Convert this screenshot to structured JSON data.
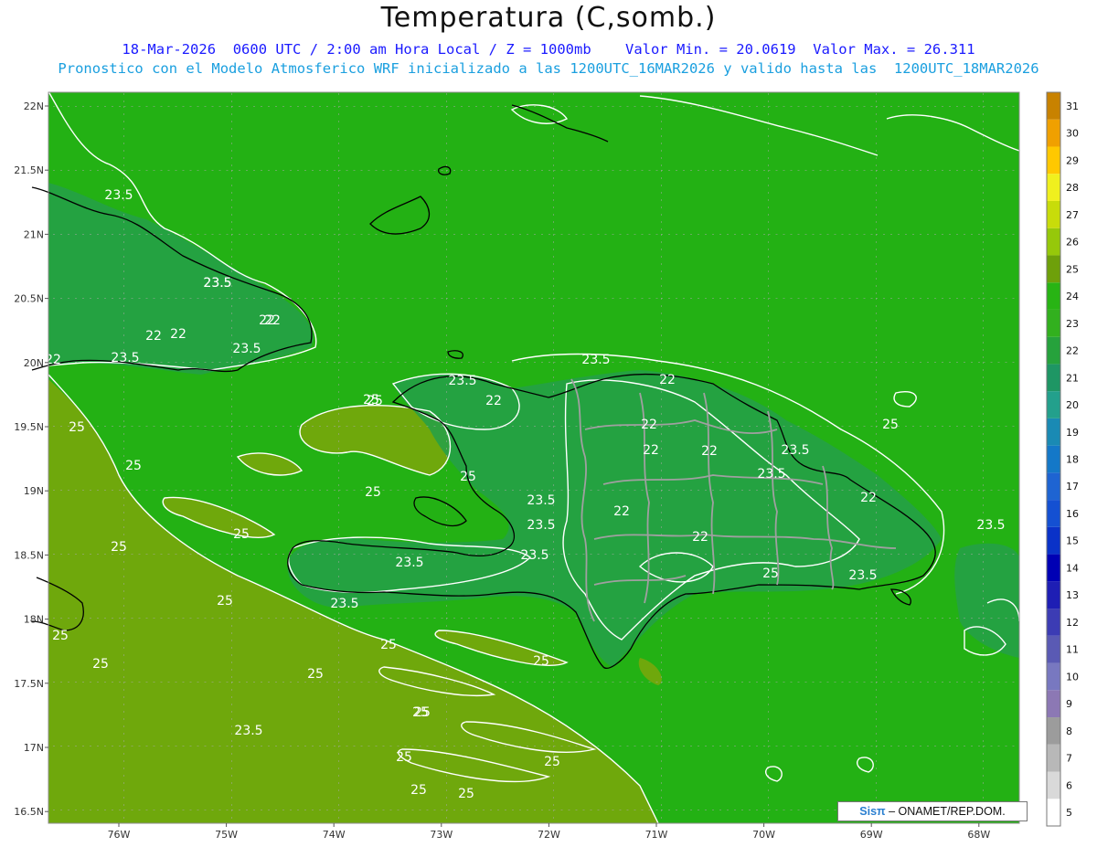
{
  "header": {
    "title": "Temperatura (C,somb.)",
    "line1": "18-Mar-2026  0600 UTC / 2:00 am Hora Local / Z = 1000mb    Valor Min. = 20.0619  Valor Max. = 26.311",
    "line2": "Pronostico con el Modelo Atmosferico WRF inicializado a las 1200UTC_16MAR2026 y valido hasta las  1200UTC_18MAR2026"
  },
  "axes": {
    "lat_ticks": [
      "22N",
      "21.5N",
      "21N",
      "20.5N",
      "20N",
      "19.5N",
      "19N",
      "18.5N",
      "18N",
      "17.5N",
      "17N",
      "16.5N"
    ],
    "lon_ticks": [
      "76W",
      "75W",
      "74W",
      "73W",
      "72W",
      "71W",
      "70W",
      "69W",
      "68W"
    ]
  },
  "colorbar": {
    "values": [
      "5",
      "6",
      "7",
      "8",
      "9",
      "10",
      "11",
      "12",
      "13",
      "14",
      "15",
      "16",
      "17",
      "18",
      "19",
      "20",
      "21",
      "22",
      "23",
      "24",
      "25",
      "26",
      "27",
      "28",
      "29",
      "30",
      "31"
    ],
    "colors": [
      "#ffffff",
      "#d9d9d9",
      "#b8b8b8",
      "#9c9c9c",
      "#8c78b4",
      "#7878c0",
      "#5a5ab4",
      "#3c3cb4",
      "#1e1eb4",
      "#0000b4",
      "#0a32c8",
      "#1450d2",
      "#1e64d2",
      "#1478c8",
      "#1a8ab4",
      "#23a08c",
      "#1e9664",
      "#26a23c",
      "#32b01e",
      "#28b414",
      "#6ea00a",
      "#96c80a",
      "#c8dc0a",
      "#f0f01e",
      "#ffc800",
      "#f0a000",
      "#c88200"
    ]
  },
  "field": {
    "sea_color": "#23b114",
    "south_color": "#6fa80c",
    "land_cool_color": "#25a049",
    "contour_color": "#ffffff",
    "border_color": "#000000",
    "province_color": "#a0a0a0"
  },
  "contour_labels": [
    {
      "text": "23.5"
    },
    {
      "text": "22"
    },
    {
      "text": "22"
    },
    {
      "text": "22"
    },
    {
      "text": "23.5"
    },
    {
      "text": "23.5"
    },
    {
      "text": "22"
    },
    {
      "text": "23.5"
    },
    {
      "text": "22"
    },
    {
      "text": "23.5"
    },
    {
      "text": "25"
    },
    {
      "text": "25"
    },
    {
      "text": "25"
    },
    {
      "text": "25"
    },
    {
      "text": "25"
    },
    {
      "text": "25"
    },
    {
      "text": "25"
    },
    {
      "text": "25"
    },
    {
      "text": "25"
    },
    {
      "text": "25"
    },
    {
      "text": "23.5"
    },
    {
      "text": "23.5"
    },
    {
      "text": "23.5"
    },
    {
      "text": "22"
    },
    {
      "text": "22"
    },
    {
      "text": "22"
    },
    {
      "text": "22"
    },
    {
      "text": "23.5"
    },
    {
      "text": "22"
    },
    {
      "text": "23.5"
    },
    {
      "text": "23.5"
    },
    {
      "text": "23.5"
    },
    {
      "text": "22"
    },
    {
      "text": "23.5"
    },
    {
      "text": "22"
    },
    {
      "text": "23.5"
    },
    {
      "text": "23.5"
    },
    {
      "text": "22"
    },
    {
      "text": "23.5"
    },
    {
      "text": "25"
    },
    {
      "text": "25"
    },
    {
      "text": "25"
    },
    {
      "text": "25"
    },
    {
      "text": "25"
    },
    {
      "text": "25"
    },
    {
      "text": "25"
    },
    {
      "text": "25"
    },
    {
      "text": "25"
    },
    {
      "text": "25"
    },
    {
      "text": "25"
    },
    {
      "text": "25"
    }
  ],
  "credit": {
    "logo": "Sisπ",
    "text": "– ONAMET/REP.DOM."
  }
}
